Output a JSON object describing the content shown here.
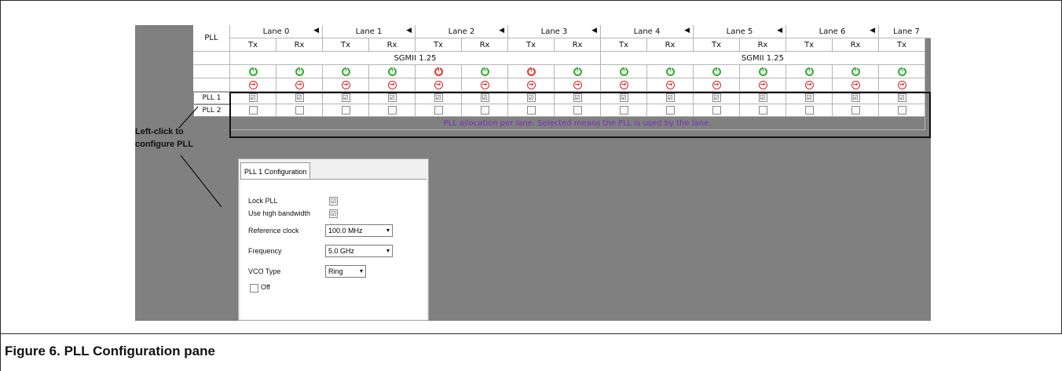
{
  "table": {
    "pll_header": "PLL",
    "lanes": [
      "Lane 0",
      "Lane 1",
      "Lane 2",
      "Lane 3",
      "Lane 4",
      "Lane 5",
      "Lane 6",
      "Lane 7"
    ],
    "lane_arrow": "◀",
    "tx_label": "Tx",
    "rx_label": "Rx",
    "protocols": [
      "SGMII 1.25",
      "SGMII 1.25"
    ],
    "power_states": [
      "green",
      "green",
      "green",
      "green",
      "red",
      "green",
      "red",
      "green",
      "green",
      "green",
      "green",
      "green",
      "green",
      "green",
      "green"
    ],
    "pll_rows": [
      "PLL 1",
      "PLL 2"
    ],
    "pll1_checked": "☑",
    "pll_note": "PLL allocation per lane. Selected means the PLL is used by the lane."
  },
  "annotation": {
    "line1": "Left-click to",
    "line2": "configure PLL"
  },
  "panel": {
    "tab": "PLL 1 Configuration",
    "lock_pll": "Lock PLL",
    "use_high_bandwidth": "Use high bandwidth",
    "reference_clock_label": "Reference clock",
    "reference_clock_value": "100.0 MHz",
    "frequency_label": "Frequency",
    "frequency_value": "5.0 GHz",
    "vco_type_label": "VCO Type",
    "vco_type_value": "Ring",
    "off_label": "Off",
    "dropdown_glyph": "▾"
  },
  "caption": "Figure 6.  PLL Configuration pane"
}
